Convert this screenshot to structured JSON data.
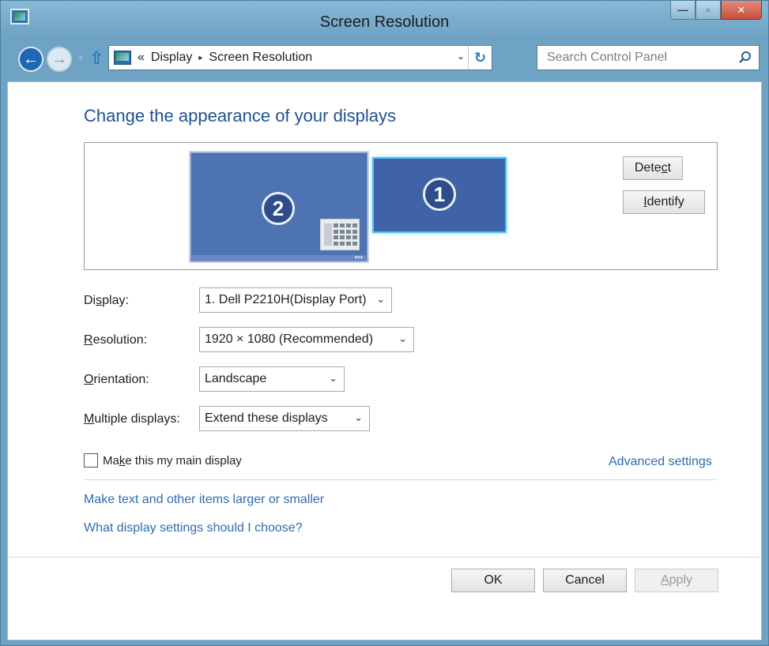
{
  "window": {
    "title": "Screen Resolution",
    "buttons": {
      "minimize": "—",
      "maximize": "▫",
      "close": "✕"
    }
  },
  "navbar": {
    "back_icon": "←",
    "forward_icon": "→",
    "up_icon": "⇧",
    "breadcrumb_prefix": "«",
    "breadcrumb": [
      "Display",
      "Screen Resolution"
    ],
    "breadcrumb_separator": "▸",
    "dropdown_icon": "⌄",
    "refresh_icon": "↻",
    "search_placeholder": "Search Control Panel"
  },
  "main": {
    "heading": "Change the appearance of your displays",
    "monitors": [
      {
        "number": "2"
      },
      {
        "number": "1"
      }
    ],
    "detect_button": {
      "pre": "Dete",
      "underline": "c",
      "post": "t"
    },
    "identify_button": {
      "pre": "",
      "underline": "I",
      "post": "dentify"
    },
    "settings": [
      {
        "label_pre": "Di",
        "label_underline": "s",
        "label_post": "play:",
        "value": "1. Dell P2210H(Display Port)"
      },
      {
        "label_pre": "",
        "label_underline": "R",
        "label_post": "esolution:",
        "value": "1920 × 1080 (Recommended)"
      },
      {
        "label_pre": "",
        "label_underline": "O",
        "label_post": "rientation:",
        "value": "Landscape"
      },
      {
        "label_pre": "",
        "label_underline": "M",
        "label_post": "ultiple displays:",
        "value": "Extend these displays"
      }
    ],
    "main_display_checkbox": {
      "pre": "Ma",
      "underline": "k",
      "post": "e this my main display",
      "checked": false
    },
    "advanced_settings_link": "Advanced settings",
    "links": [
      "Make text and other items larger or smaller",
      "What display settings should I choose?"
    ]
  },
  "footer": {
    "ok": "OK",
    "cancel": "Cancel",
    "apply_underline": "A",
    "apply_post": "pply"
  },
  "colors": {
    "chrome": "#6fa3c4",
    "heading": "#1e5293",
    "link": "#2f6bb0",
    "monitor": "#4e73b3",
    "selected_monitor_border": "#4fc1f2"
  }
}
